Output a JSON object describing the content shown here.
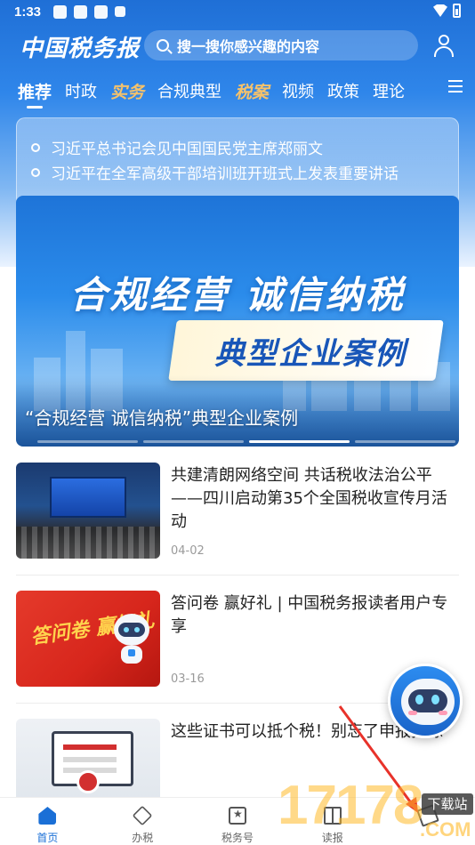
{
  "status_bar": {
    "time": "1:33"
  },
  "header": {
    "logo": "中国税务报",
    "search_placeholder": "搜一搜你感兴趣的内容"
  },
  "tabs": [
    {
      "label": "推荐"
    },
    {
      "label": "时政"
    },
    {
      "label": "实务"
    },
    {
      "label": "合规典型"
    },
    {
      "label": "税案"
    },
    {
      "label": "视频"
    },
    {
      "label": "政策"
    },
    {
      "label": "理论"
    }
  ],
  "ticker": [
    "习近平总书记会见中国国民党主席郑丽文",
    "习近平在全军高级干部培训班开班式上发表重要讲话"
  ],
  "banner": {
    "title": "合规经营 诚信纳税",
    "subtitle": "典型企业案例",
    "caption": "“合规经营 诚信纳税”典型企业案例"
  },
  "news": [
    {
      "title": "共建清朗网络空间 共话税收法治公平——四川启动第35个全国税收宣传月活动",
      "date": "04-02"
    },
    {
      "title": "答问卷 赢好礼 | 中国税务报读者用户专享",
      "date": "03-16",
      "thumb_text": "答问卷 赢好礼"
    },
    {
      "title": "这些证书可以抵个税！别忘了申报扣除"
    }
  ],
  "bottom_nav": [
    {
      "label": "首页",
      "icon": "home-icon"
    },
    {
      "label": "办税",
      "icon": "tax-icon"
    },
    {
      "label": "税务号",
      "icon": "account-icon"
    },
    {
      "label": "读报",
      "icon": "newspaper-icon"
    },
    {
      "label": "",
      "icon": "edit-icon"
    }
  ],
  "watermark": {
    "number": "17178",
    "box": "下载站",
    "com": ".COM"
  },
  "colors": {
    "brand_blue": "#1a6fd6",
    "gold": "#f5c26b"
  }
}
